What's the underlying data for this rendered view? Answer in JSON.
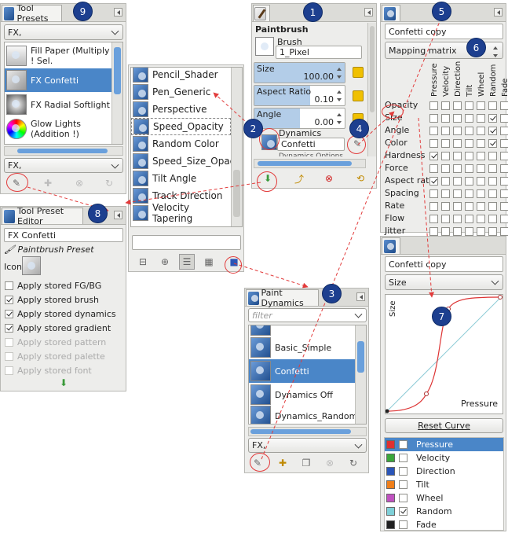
{
  "callouts": [
    "1",
    "2",
    "3",
    "4",
    "5",
    "6",
    "7",
    "8",
    "9"
  ],
  "tool_presets": {
    "tab": "Tool Presets",
    "filter_value": "FX,",
    "tag_value": "FX,",
    "items": [
      {
        "label": "Fill Paper (Multiply ! Sel."
      },
      {
        "label": "FX Confetti",
        "selected": true
      },
      {
        "label": "FX Radial Softlight"
      },
      {
        "label": "Glow Lights (Addition !)"
      }
    ]
  },
  "brush_list": {
    "items": [
      "Pencil_Shader",
      "Pen_Generic",
      "Perspective",
      "Speed_Opacity",
      "Random Color",
      "Speed_Size_Opacit",
      "Tilt Angle",
      "Track Direction",
      "Velocity Tapering"
    ]
  },
  "paintbrush": {
    "title": "Paintbrush",
    "brush_label": "Brush",
    "brush_value": "1_Pixel",
    "sliders": [
      {
        "name": "Size",
        "value": "100.00",
        "fill": 1.0
      },
      {
        "name": "Aspect Ratio",
        "value": "0.10",
        "fill": 0.51
      },
      {
        "name": "Angle",
        "value": "0.00",
        "fill": 0.5
      }
    ],
    "dynamics_label": "Dynamics",
    "dynamics_value": "Confetti",
    "cut_text": "Dynamics Options"
  },
  "dyn_editor": {
    "name_value": "Confetti copy",
    "mode_value": "Mapping matrix",
    "columns": [
      "Pressure",
      "Velocity",
      "Direction",
      "Tilt",
      "Wheel",
      "Random",
      "Fade"
    ],
    "rows": [
      {
        "label": "Opacity",
        "checks": [
          false,
          false,
          false,
          false,
          false,
          false,
          false
        ]
      },
      {
        "label": "Size",
        "checks": [
          false,
          false,
          false,
          false,
          false,
          true,
          false
        ]
      },
      {
        "label": "Angle",
        "checks": [
          false,
          false,
          false,
          false,
          false,
          true,
          false
        ]
      },
      {
        "label": "Color",
        "checks": [
          false,
          false,
          false,
          false,
          false,
          true,
          false
        ]
      },
      {
        "label": "Hardness",
        "checks": [
          true,
          false,
          false,
          false,
          false,
          false,
          false
        ]
      },
      {
        "label": "Force",
        "checks": [
          false,
          false,
          false,
          false,
          false,
          false,
          false
        ]
      },
      {
        "label": "Aspect ratio",
        "checks": [
          true,
          false,
          false,
          false,
          false,
          false,
          false
        ]
      },
      {
        "label": "Spacing",
        "checks": [
          false,
          false,
          false,
          false,
          false,
          false,
          false
        ]
      },
      {
        "label": "Rate",
        "checks": [
          false,
          false,
          false,
          false,
          false,
          false,
          false
        ]
      },
      {
        "label": "Flow",
        "checks": [
          false,
          false,
          false,
          false,
          false,
          false,
          false
        ]
      },
      {
        "label": "Jitter",
        "checks": [
          false,
          false,
          false,
          false,
          false,
          false,
          false
        ]
      }
    ]
  },
  "curve_editor": {
    "name_value": "Confetti copy",
    "param_value": "Size",
    "y_label": "Size",
    "x_label": "Pressure",
    "reset_label": "Reset Curve",
    "inputs": [
      {
        "label": "Pressure",
        "color": "#e03030",
        "checked": false,
        "selected": true
      },
      {
        "label": "Velocity",
        "color": "#3aa63a",
        "checked": false
      },
      {
        "label": "Direction",
        "color": "#2a55b8",
        "checked": false
      },
      {
        "label": "Tilt",
        "color": "#f07f1a",
        "checked": false
      },
      {
        "label": "Wheel",
        "color": "#c052c0",
        "checked": false
      },
      {
        "label": "Random",
        "color": "#7fd0d8",
        "checked": true
      },
      {
        "label": "Fade",
        "color": "#202020",
        "checked": false
      }
    ]
  },
  "preset_editor": {
    "tab": "Tool Preset Editor",
    "name_value": "FX Confetti",
    "tool_name": "Paintbrush Preset",
    "icon_label": "Icon:",
    "options": [
      {
        "label": "Apply stored FG/BG",
        "checked": false,
        "enabled": true
      },
      {
        "label": "Apply stored brush",
        "checked": true,
        "enabled": true
      },
      {
        "label": "Apply stored dynamics",
        "checked": true,
        "enabled": true
      },
      {
        "label": "Apply stored gradient",
        "checked": true,
        "enabled": true
      },
      {
        "label": "Apply stored pattern",
        "checked": false,
        "enabled": false
      },
      {
        "label": "Apply stored palette",
        "checked": false,
        "enabled": false
      },
      {
        "label": "Apply stored font",
        "checked": false,
        "enabled": false
      }
    ]
  },
  "paint_dynamics": {
    "tab": "Paint Dynamics",
    "filter_placeholder": "filter",
    "items": [
      {
        "label": "Basic_Simple"
      },
      {
        "label": "Confetti",
        "selected": true
      },
      {
        "label": "Dynamics Off"
      },
      {
        "label": "Dynamics_Random"
      }
    ],
    "tag_value": "FX,"
  },
  "colors": {
    "accent": "#4a86c8",
    "callout": "#1d3f8f",
    "annotation": "#e23b3b"
  }
}
